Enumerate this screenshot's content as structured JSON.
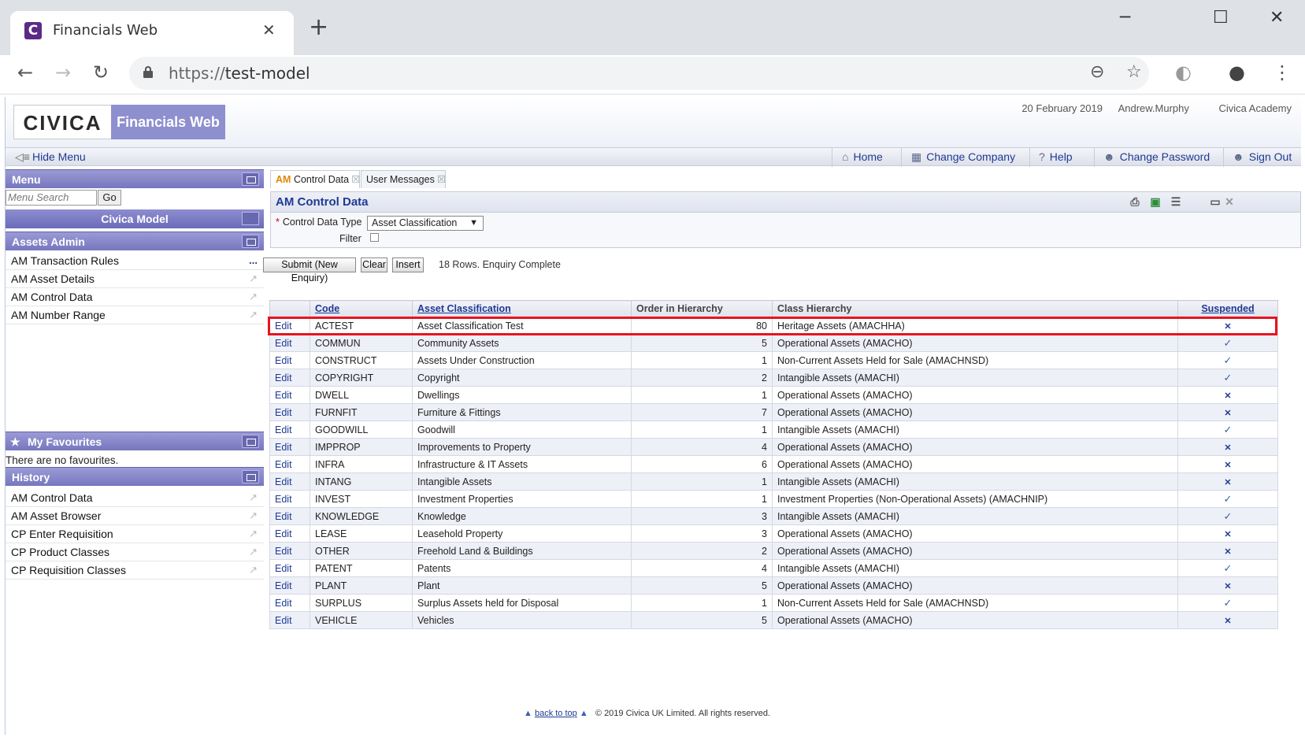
{
  "browser": {
    "tab_title": "Financials Web",
    "favicon_letter": "C",
    "url_scheme": "https://",
    "url_host": "test-model",
    "close_glyph": "✕",
    "newtab_glyph": "+",
    "minimize_glyph": "─",
    "maximize_glyph": "☐",
    "window_close_glyph": "✕",
    "back_glyph": "←",
    "forward_glyph": "→",
    "reload_glyph": "↻",
    "zoom_glyph": "⊖",
    "star_glyph": "☆",
    "ext_glyph": "◐",
    "profile_glyph": "●",
    "kebab_glyph": "⋮"
  },
  "header": {
    "logo_text": "CIVICA",
    "product": "Financials Web",
    "date": "20 February 2019",
    "user": "Andrew.Murphy",
    "org": "Civica Academy"
  },
  "navbar": {
    "hide_menu": "Hide Menu",
    "home": "Home",
    "change_company": "Change Company",
    "help": "Help",
    "change_password": "Change Password",
    "sign_out": "Sign Out"
  },
  "sidebar": {
    "menu_title": "Menu",
    "search_placeholder": "Menu Search",
    "go": "Go",
    "model_title": "Civica Model",
    "section_title": "Assets Admin",
    "items": [
      "AM Transaction Rules",
      "AM Asset Details",
      "AM Control Data",
      "AM Number Range"
    ],
    "favourites_title": "My Favourites",
    "no_favourites": "There are no favourites.",
    "history_title": "History",
    "history": [
      "AM Control Data",
      "AM Asset Browser",
      "CP Enter Requisition",
      "CP Product Classes",
      "CP Requisition Classes"
    ]
  },
  "tabs": {
    "active_prefix": "AM",
    "active_label": "Control Data",
    "second_label": "User Messages"
  },
  "panel": {
    "title": "AM Control Data",
    "control_label": "Control Data Type",
    "control_value": "Asset Classification",
    "filter_label": "Filter",
    "submit": "Submit (New Enquiry)",
    "clear": "Clear",
    "insert": "Insert",
    "status": "18 Rows. Enquiry Complete"
  },
  "table": {
    "headers": [
      "",
      "Code",
      "Asset Classification",
      "Order in Hierarchy",
      "Class Hierarchy",
      "Suspended"
    ],
    "edit_label": "Edit",
    "rows": [
      [
        "ACTEST",
        "Asset Classification Test",
        "80",
        "Heritage Assets (AMACHHA)",
        "N"
      ],
      [
        "COMMUN",
        "Community Assets",
        "5",
        "Operational Assets (AMACHO)",
        "Y"
      ],
      [
        "CONSTRUCT",
        "Assets Under Construction",
        "1",
        "Non-Current Assets Held for Sale (AMACHNSD)",
        "Y"
      ],
      [
        "COPYRIGHT",
        "Copyright",
        "2",
        "Intangible Assets (AMACHI)",
        "Y"
      ],
      [
        "DWELL",
        "Dwellings",
        "1",
        "Operational Assets (AMACHO)",
        "N"
      ],
      [
        "FURNFIT",
        "Furniture & Fittings",
        "7",
        "Operational Assets (AMACHO)",
        "N"
      ],
      [
        "GOODWILL",
        "Goodwill",
        "1",
        "Intangible Assets (AMACHI)",
        "Y"
      ],
      [
        "IMPPROP",
        "Improvements to Property",
        "4",
        "Operational Assets (AMACHO)",
        "N"
      ],
      [
        "INFRA",
        "Infrastructure & IT Assets",
        "6",
        "Operational Assets (AMACHO)",
        "N"
      ],
      [
        "INTANG",
        "Intangible Assets",
        "1",
        "Intangible Assets (AMACHI)",
        "N"
      ],
      [
        "INVEST",
        "Investment Properties",
        "1",
        "Investment Properties (Non-Operational Assets) (AMACHNIP)",
        "Y"
      ],
      [
        "KNOWLEDGE",
        "Knowledge",
        "3",
        "Intangible Assets (AMACHI)",
        "Y"
      ],
      [
        "LEASE",
        "Leasehold Property",
        "3",
        "Operational Assets (AMACHO)",
        "N"
      ],
      [
        "OTHER",
        "Freehold Land & Buildings",
        "2",
        "Operational Assets (AMACHO)",
        "N"
      ],
      [
        "PATENT",
        "Patents",
        "4",
        "Intangible Assets (AMACHI)",
        "Y"
      ],
      [
        "PLANT",
        "Plant",
        "5",
        "Operational Assets (AMACHO)",
        "N"
      ],
      [
        "SURPLUS",
        "Surplus Assets held for Disposal",
        "1",
        "Non-Current Assets Held for Sale (AMACHNSD)",
        "Y"
      ],
      [
        "VEHICLE",
        "Vehicles",
        "5",
        "Operational Assets (AMACHO)",
        "N"
      ]
    ]
  },
  "footer": {
    "back_to_top": "back to top",
    "copyright": "© 2019 Civica UK Limited. All rights reserved."
  }
}
